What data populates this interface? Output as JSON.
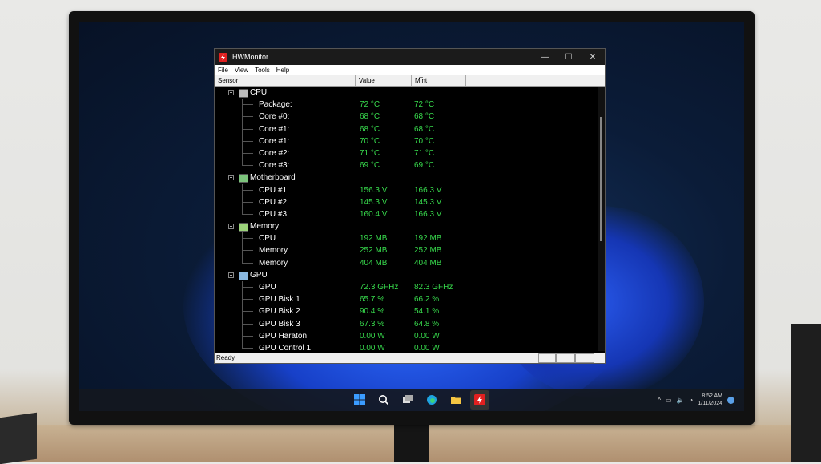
{
  "window": {
    "title": "HWMonitor",
    "controls": {
      "minimize": "—",
      "maximize": "☐",
      "close": "✕"
    }
  },
  "menu": [
    "File",
    "View",
    "Tools",
    "Help"
  ],
  "columns": {
    "sensor": "Sensor",
    "value": "Value",
    "max": "Mi̅nt"
  },
  "groups": [
    {
      "name": "CPU",
      "icon": "cpu-chip-icon",
      "items": [
        {
          "label": "Package:",
          "value": "72 °C",
          "max": "72 °C"
        },
        {
          "label": "Core #0:",
          "value": "68 °C",
          "max": "68 °C"
        },
        {
          "label": "Core #1:",
          "value": "68 °C",
          "max": "68 °C"
        },
        {
          "label": "Core #1:",
          "value": "70 °C",
          "max": "70 °C"
        },
        {
          "label": "Core #2:",
          "value": "71 °C",
          "max": "71 °C"
        },
        {
          "label": "Core #3:",
          "value": "69 °C",
          "max": "69 °C"
        }
      ]
    },
    {
      "name": "Motherboard",
      "icon": "motherboard-icon",
      "items": [
        {
          "label": "CPU #1",
          "value": "156.3 V",
          "max": "166.3 V"
        },
        {
          "label": "CPU #2",
          "value": "145.3 V",
          "max": "145.3 V"
        },
        {
          "label": "CPU #3",
          "value": "160.4 V",
          "max": "166.3 V"
        }
      ]
    },
    {
      "name": "Memory",
      "icon": "memory-module-icon",
      "items": [
        {
          "label": "CPU",
          "value": "192 MB",
          "max": "192 MB"
        },
        {
          "label": "Memory",
          "value": "252 MB",
          "max": "252 MB"
        },
        {
          "label": "Memory",
          "value": "404 MB",
          "max": "404 MB"
        }
      ]
    },
    {
      "name": "GPU",
      "icon": "gpu-card-icon",
      "items": [
        {
          "label": "GPU",
          "value": "72.3 GFHz",
          "max": "82.3 GFHz"
        },
        {
          "label": "GPU Bisk 1",
          "value": "65.7 %",
          "max": "66.2 %"
        },
        {
          "label": "GPU Bisk 2",
          "value": "90.4 %",
          "max": "54.1 %"
        },
        {
          "label": "GPU Bisk 3",
          "value": "67.3 %",
          "max": "64.8 %"
        },
        {
          "label": "GPU Haraton",
          "value": "0.00 W",
          "max": "0.00 W"
        },
        {
          "label": "GPU Control 1",
          "value": "0.00 W",
          "max": "0.00 W"
        }
      ]
    }
  ],
  "status": {
    "text": "Ready"
  },
  "taskbar": {
    "icons": [
      "windows-start-icon",
      "search-icon",
      "task-view-icon",
      "edge-browser-icon",
      "file-explorer-icon",
      "hwmonitor-icon"
    ],
    "clock": {
      "time": "8:52 AM",
      "date": "1/11/2024"
    }
  },
  "colors": {
    "value_green": "#37d94c",
    "accent_red": "#e02020",
    "window_bg": "#000000"
  }
}
